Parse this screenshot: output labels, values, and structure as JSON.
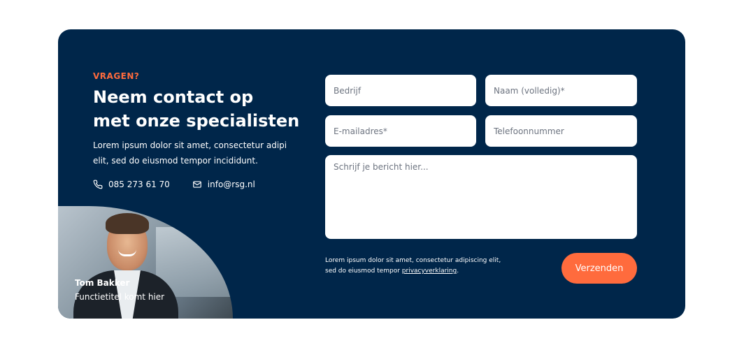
{
  "contact": {
    "eyebrow": "VRAGEN?",
    "title_line1": "Neem contact op",
    "title_line2": "met onze specialisten",
    "intro": "Lorem ipsum dolor sit amet, consectetur adipi elit, sed do eiusmod tempor incididunt.",
    "phone": "085 273 61 70",
    "email": "info@rsg.nl",
    "person_name": "Tom Bakker",
    "person_role": "Functietitel komt hier"
  },
  "form": {
    "company_placeholder": "Bedrijf",
    "name_placeholder": "Naam (volledig)*",
    "email_placeholder": "E-mailadres*",
    "phone_placeholder": "Telefoonnummer",
    "message_placeholder": "Schrijf je bericht hier...",
    "disclaimer_text": "Lorem ipsum dolor sit amet, consectetur adipiscing elit, sed do eiusmod tempor ",
    "privacy_link": "privacyverklaring",
    "disclaimer_end": ".",
    "submit_label": "Verzenden"
  },
  "icons": {
    "phone": "phone-icon",
    "email": "envelope-icon"
  },
  "colors": {
    "card_bg": "#00264a",
    "accent": "#ff6b3d",
    "page_bg": "#ffffff"
  }
}
